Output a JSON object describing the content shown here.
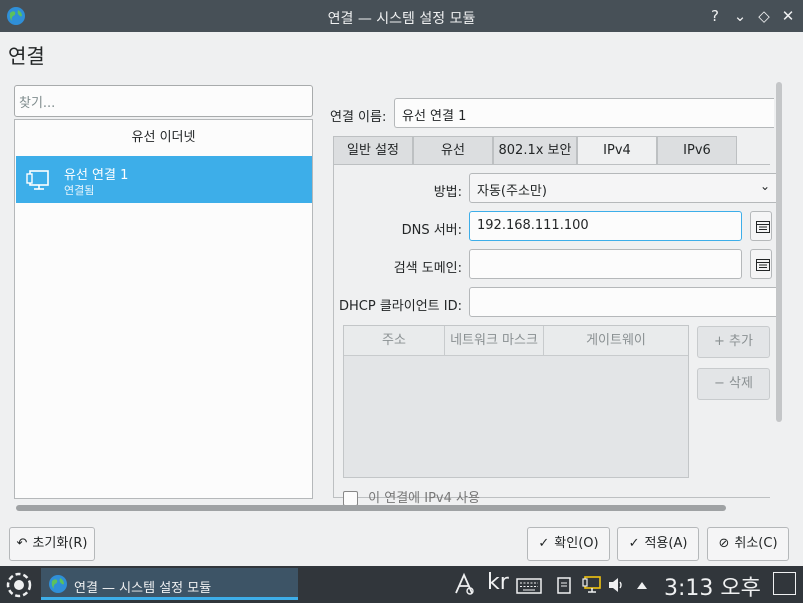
{
  "window": {
    "title": "연결 — 시스템 설정 모듈",
    "help": "?",
    "minimize": "⌄",
    "maximize": "◇",
    "close": "✕"
  },
  "page_title": "연결",
  "search": {
    "placeholder": "찾기..."
  },
  "connections": {
    "group_header": "유선 이더넷",
    "items": [
      {
        "name": "유선 연결 1",
        "status": "연결됨"
      }
    ]
  },
  "editor": {
    "conn_name_label": "연결 이름:",
    "conn_name_value": "유선 연결 1",
    "tabs": [
      "일반 설정",
      "유선",
      "802.1x 보안",
      "IPv4",
      "IPv6"
    ],
    "active_tab": "IPv4",
    "method_label": "방법:",
    "method_value": "자동(주소만)",
    "dns_label": "DNS 서버:",
    "dns_value": "192.168.111.100",
    "search_domain_label": "검색 도메인:",
    "search_domain_value": "",
    "dhcp_label": "DHCP 클라이언트 ID:",
    "dhcp_value": "",
    "table_headers": [
      "주소",
      "네트워크 마스크",
      "게이트웨이"
    ],
    "add_button": "+ 추가",
    "remove_button": "− 삭제",
    "checkbox_label": "이 연결에 IPv4 사용"
  },
  "buttons": {
    "reset": "초기화(R)",
    "ok": "확인(O)",
    "apply": "적용(A)",
    "cancel": "취소(C)"
  },
  "taskbar": {
    "task_label": "연결 — 시스템 설정 모듈",
    "keyboard_layout": "kr",
    "clock": "3:13 오후"
  },
  "colors": {
    "titlebar": "#475057",
    "selection": "#3daee9",
    "taskbar": "#31363b",
    "window_bg": "#eff0f1"
  }
}
